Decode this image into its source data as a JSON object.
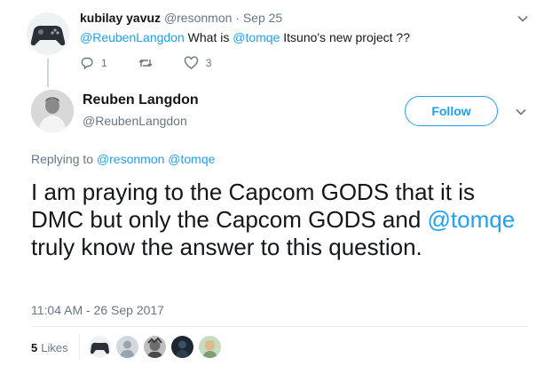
{
  "reply": {
    "author_name": "kubilay yavuz",
    "author_handle": "@resonmon",
    "date": "· Sep 25",
    "mention": "@ReubenLangdon",
    "text_middle": " What is ",
    "mention2": "@tomqe",
    "text_end": " Itsuno's new project ??",
    "reply_count": "1",
    "like_count": "3",
    "icons": [
      "reply-icon",
      "retweet-icon",
      "heart-icon",
      "chevron-down-icon"
    ]
  },
  "main": {
    "author_name": "Reuben Langdon",
    "author_handle": "@ReubenLangdon",
    "follow_label": "Follow",
    "replying_prefix": "Replying to ",
    "replying_to_1": "@resonmon",
    "replying_to_2": "@tomqe",
    "body_part1": "I am praying to the Capcom GODS that it is DMC but only the Capcom GODS and ",
    "body_mention": "@tomqe",
    "body_part2": " truly know the answer to this question.",
    "timestamp": "11:04 AM - 26 Sep 2017",
    "likes_count": "5",
    "likes_label": "Likes"
  },
  "colors": {
    "accent": "#1da1f2",
    "text": "#14171a",
    "muted": "#657786",
    "border": "#e6ecf0"
  }
}
